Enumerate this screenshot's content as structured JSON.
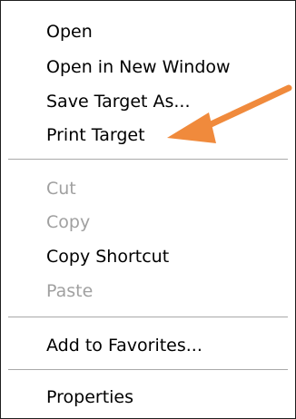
{
  "menu": {
    "items": [
      {
        "label": "Open",
        "enabled": true
      },
      {
        "label": "Open in New Window",
        "enabled": true
      },
      {
        "label": "Save Target As...",
        "enabled": true
      },
      {
        "label": "Print Target",
        "enabled": true
      },
      {
        "label": "Cut",
        "enabled": false
      },
      {
        "label": "Copy",
        "enabled": false
      },
      {
        "label": "Copy Shortcut",
        "enabled": true
      },
      {
        "label": "Paste",
        "enabled": false
      },
      {
        "label": "Add to Favorites...",
        "enabled": true
      },
      {
        "label": "Properties",
        "enabled": true
      }
    ]
  },
  "annotation": {
    "arrow_color": "#f08a3c",
    "points_to": "Print Target"
  },
  "colors": {
    "text": "#000000",
    "disabled_text": "#a0a0a0",
    "separator": "#a9a9a9",
    "border": "#1f1f1f"
  }
}
